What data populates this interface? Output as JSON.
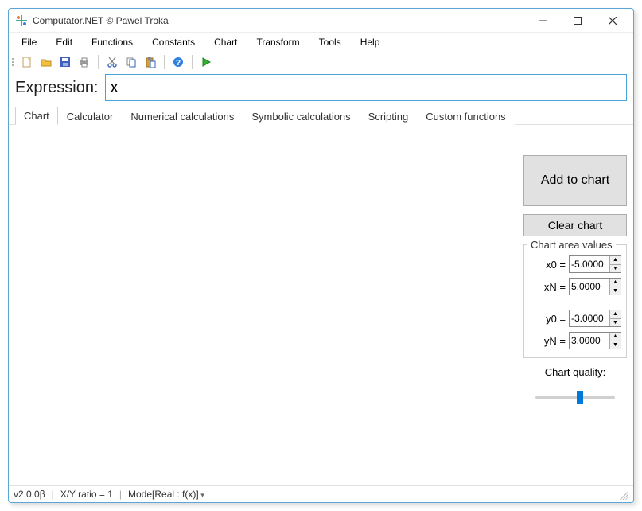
{
  "window": {
    "title": "Computator.NET © Pawel Troka"
  },
  "menubar": [
    "File",
    "Edit",
    "Functions",
    "Constants",
    "Chart",
    "Transform",
    "Tools",
    "Help"
  ],
  "toolbar_icons": [
    "new-file-icon",
    "open-folder-icon",
    "save-icon",
    "print-icon",
    "cut-icon",
    "copy-icon",
    "paste-icon",
    "help-icon",
    "run-icon"
  ],
  "expression": {
    "label": "Expression:",
    "value": "x"
  },
  "tabs": [
    {
      "label": "Chart",
      "active": true
    },
    {
      "label": "Calculator",
      "active": false
    },
    {
      "label": "Numerical calculations",
      "active": false
    },
    {
      "label": "Symbolic calculations",
      "active": false
    },
    {
      "label": "Scripting",
      "active": false
    },
    {
      "label": "Custom functions",
      "active": false
    }
  ],
  "side": {
    "add_to_chart": "Add to chart",
    "clear_chart": "Clear chart",
    "area_values_label": "Chart area values",
    "x0_label": "x0 =",
    "x0_value": "-5.0000",
    "xN_label": "xN =",
    "xN_value": "5.0000",
    "y0_label": "y0 =",
    "y0_value": "-3.0000",
    "yN_label": "yN =",
    "yN_value": "3.0000",
    "quality_label": "Chart quality:"
  },
  "status": {
    "version": "v2.0.0β",
    "ratio": "X/Y ratio = 1",
    "mode": "Mode[Real : f(x)]"
  }
}
